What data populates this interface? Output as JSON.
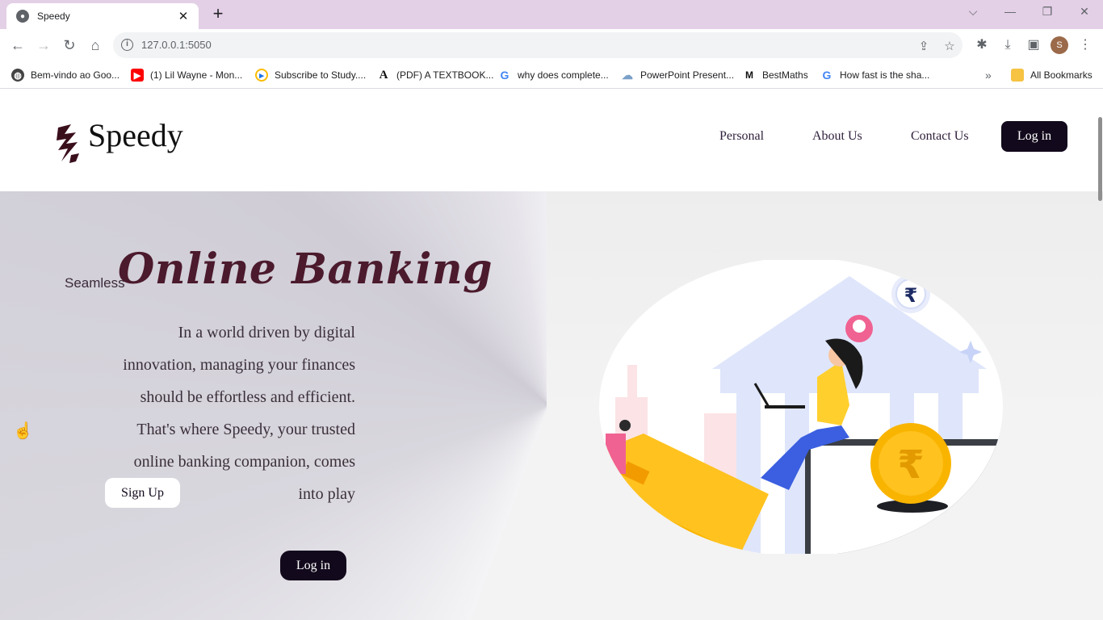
{
  "browser": {
    "tab_title": "Speedy",
    "url": "127.0.0.1:5050",
    "profile_initial": "S",
    "bookmarks": [
      {
        "label": "Bem-vindo ao Goo...",
        "icon": "globe-icon"
      },
      {
        "label": "(1) Lil Wayne - Mon...",
        "icon": "youtube-icon"
      },
      {
        "label": "Subscribe to Study....",
        "icon": "play-circle-icon"
      },
      {
        "label": "(PDF) A TEXTBOOK...",
        "icon": "academia-icon"
      },
      {
        "label": "why does complete...",
        "icon": "google-icon"
      },
      {
        "label": "PowerPoint Present...",
        "icon": "cloud-icon"
      },
      {
        "label": "BestMaths",
        "icon": "bestmaths-icon"
      },
      {
        "label": "How fast is the sha...",
        "icon": "google-icon"
      }
    ],
    "all_bookmarks": "All Bookmarks"
  },
  "site": {
    "brand": "Speedy",
    "nav": {
      "personal": "Personal",
      "about": "About Us",
      "contact": "Contact Us",
      "login": "Log in"
    }
  },
  "hero": {
    "kicker": "Seamless",
    "title": "Online Banking",
    "paragraph_lines": [
      "In a world driven by digital",
      "innovation, managing your finances",
      "should be effortless and efficient.",
      "That's where Speedy, your trusted",
      "online banking companion, comes",
      "into play"
    ],
    "signup": "Sign Up",
    "login": "Log in",
    "rupee_symbol": "₹"
  },
  "colors": {
    "brand_dark": "#12091c",
    "title_color": "#4b1a2c",
    "tab_bar": "#e3cfe6"
  }
}
